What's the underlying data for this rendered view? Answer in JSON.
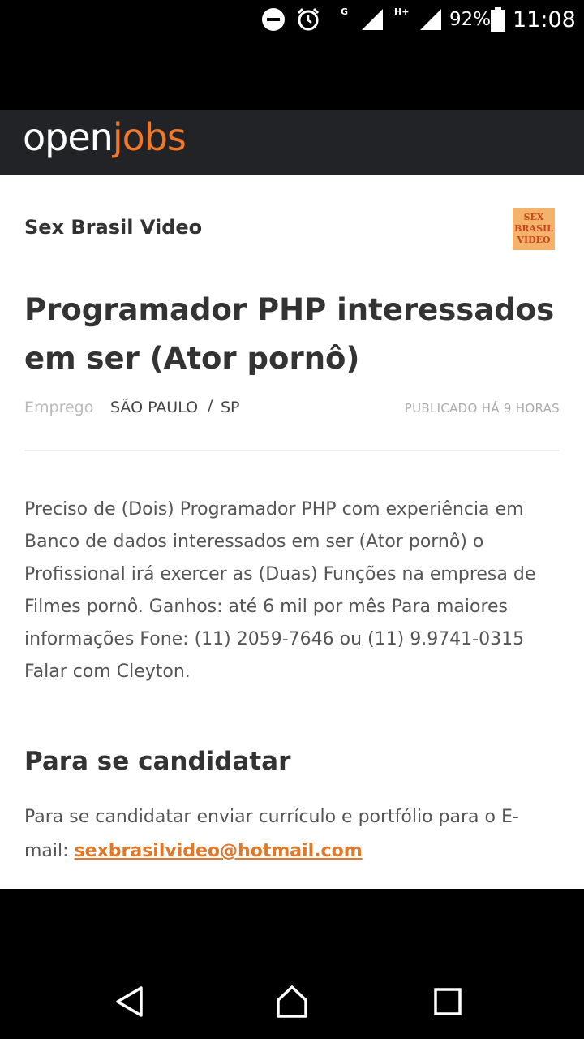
{
  "status_bar": {
    "network_g": "G",
    "network_hplus": "H+",
    "battery": "92%",
    "time": "11:08",
    "icons": [
      "do-not-disturb-icon",
      "alarm-icon",
      "signal-icon",
      "signal-icon",
      "battery-icon"
    ]
  },
  "header": {
    "logo_part1": "open",
    "logo_part2": "jobs",
    "brand_color": "#f0782a"
  },
  "company": {
    "name": "Sex Brasil Video",
    "logo_lines": [
      "SEX",
      "BRASIL",
      "VIDEO"
    ]
  },
  "job": {
    "title": "Programador PHP interessados em ser (Ator pornô)",
    "type": "Emprego",
    "city": "SÃO PAULO",
    "separator": "/",
    "state": "SP",
    "published": "PUBLICADO HÁ 9 HORAS",
    "description": "Preciso de (Dois) Programador PHP com experiência em Banco de dados interessados em ser (Ator pornô) o Profissional irá exercer as (Duas) Funções na empresa de Filmes pornô. Ganhos: até 6 mil por mês Para maiores informações Fone: (11) 2059-7646 ou (11) 9.9741-0315 Falar com Cleyton."
  },
  "apply": {
    "heading": "Para se candidatar",
    "text": "Para se candidatar enviar currículo e portfólio para o E-mail: ",
    "email": "sexbrasilvideo@hotmail.com"
  },
  "nav": {
    "icons": [
      "back-icon",
      "home-icon",
      "recents-icon"
    ]
  }
}
